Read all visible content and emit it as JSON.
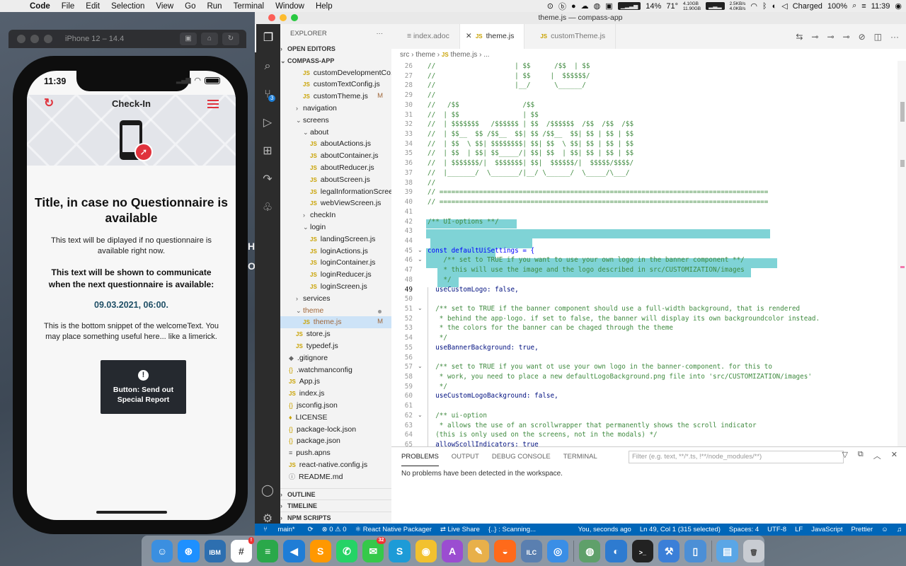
{
  "menubar": {
    "app_name": "Code",
    "items": [
      "File",
      "Edit",
      "Selection",
      "View",
      "Go",
      "Run",
      "Terminal",
      "Window",
      "Help"
    ],
    "status": {
      "cpu": "14%",
      "temp": "71°",
      "mem_used": "4.10GB",
      "mem_free": "11.90GB",
      "net_up": "2.5KB/s",
      "net_down": "4.0KB/s",
      "battery_label": "Charged",
      "battery_pct": "100%",
      "time": "11:39"
    }
  },
  "simulator": {
    "title": "iPhone 12 – 14.4",
    "status_time": "11:39",
    "app_title": "Check-In",
    "heading": "Title, in case no Questionnaire is available",
    "text1": "This text will be diplayed if no questionnaire is available right now.",
    "text2": "This text will be shown to communicate when the next questionnaire is available:",
    "date": "09.03.2021, 06:00.",
    "bottom": "This is the bottom snippet of the welcomeText. You may place something useful here... like a limerick.",
    "button_label": "Button: Send out Special Report"
  },
  "vscode": {
    "window_title": "theme.js — compass-app",
    "explorer_label": "EXPLORER",
    "open_editors_label": "OPEN EDITORS",
    "project_label": "COMPASS-APP",
    "tree": [
      {
        "label": "customDevelopmentCo...",
        "type": "js",
        "indent": 2
      },
      {
        "label": "customTextConfig.js",
        "type": "js",
        "indent": 2
      },
      {
        "label": "customTheme.js",
        "type": "js",
        "indent": 2,
        "status": "M"
      },
      {
        "label": "navigation",
        "type": "folder",
        "indent": 1,
        "arrow": "›"
      },
      {
        "label": "screens",
        "type": "folder",
        "indent": 1,
        "arrow": "⌄"
      },
      {
        "label": "about",
        "type": "folder",
        "indent": 2,
        "arrow": "⌄"
      },
      {
        "label": "aboutActions.js",
        "type": "js",
        "indent": 3
      },
      {
        "label": "aboutContainer.js",
        "type": "js",
        "indent": 3
      },
      {
        "label": "aboutReducer.js",
        "type": "js",
        "indent": 3
      },
      {
        "label": "aboutScreen.js",
        "type": "js",
        "indent": 3
      },
      {
        "label": "legalInformationScree...",
        "type": "js",
        "indent": 3
      },
      {
        "label": "webViewScreen.js",
        "type": "js",
        "indent": 3
      },
      {
        "label": "checkIn",
        "type": "folder",
        "indent": 2,
        "arrow": "›"
      },
      {
        "label": "login",
        "type": "folder",
        "indent": 2,
        "arrow": "⌄"
      },
      {
        "label": "landingScreen.js",
        "type": "js",
        "indent": 3
      },
      {
        "label": "loginActions.js",
        "type": "js",
        "indent": 3
      },
      {
        "label": "loginContainer.js",
        "type": "js",
        "indent": 3
      },
      {
        "label": "loginReducer.js",
        "type": "js",
        "indent": 3
      },
      {
        "label": "loginScreen.js",
        "type": "js",
        "indent": 3
      },
      {
        "label": "services",
        "type": "folder",
        "indent": 1,
        "arrow": "›"
      },
      {
        "label": "theme",
        "type": "folder",
        "indent": 1,
        "arrow": "⌄",
        "dot": true,
        "color": "#a0673a"
      },
      {
        "label": "theme.js",
        "type": "js",
        "indent": 2,
        "status": "M",
        "selected": true,
        "color": "#a0673a"
      },
      {
        "label": "store.js",
        "type": "js",
        "indent": 1
      },
      {
        "label": "typedef.js",
        "type": "js",
        "indent": 1
      },
      {
        "label": ".gitignore",
        "type": "git",
        "indent": 0
      },
      {
        "label": ".watchmanconfig",
        "type": "json",
        "indent": 0
      },
      {
        "label": "App.js",
        "type": "js",
        "indent": 0
      },
      {
        "label": "index.js",
        "type": "js",
        "indent": 0
      },
      {
        "label": "jsconfig.json",
        "type": "json",
        "indent": 0
      },
      {
        "label": "LICENSE",
        "type": "lic",
        "indent": 0
      },
      {
        "label": "package-lock.json",
        "type": "json",
        "indent": 0
      },
      {
        "label": "package.json",
        "type": "json",
        "indent": 0
      },
      {
        "label": "push.apns",
        "type": "other",
        "indent": 0
      },
      {
        "label": "react-native.config.js",
        "type": "js",
        "indent": 0
      },
      {
        "label": "README.md",
        "type": "info",
        "indent": 0
      }
    ],
    "outline_sections": [
      "OUTLINE",
      "TIMELINE",
      "NPM SCRIPTS"
    ],
    "tabs": [
      {
        "label": "index.adoc",
        "active": false
      },
      {
        "label": "theme.js",
        "active": true
      },
      {
        "label": "customTheme.js",
        "active": false
      }
    ],
    "breadcrumb": [
      "src",
      "theme",
      "theme.js",
      "..."
    ],
    "code_lines": [
      {
        "n": "26",
        "t": "//                    | $$      /$$  | $$",
        "cls": "c"
      },
      {
        "n": "27",
        "t": "//                    | $$     |  $$$$$$/",
        "cls": "c"
      },
      {
        "n": "28",
        "t": "//                    |__/      \\______/",
        "cls": "c"
      },
      {
        "n": "29",
        "t": "//",
        "cls": "c"
      },
      {
        "n": "30",
        "t": "//   /$$                /$$",
        "cls": "c"
      },
      {
        "n": "31",
        "t": "//  | $$                | $$",
        "cls": "c"
      },
      {
        "n": "32",
        "t": "//  | $$$$$$$   /$$$$$$ | $$  /$$$$$$  /$$  /$$  /$$",
        "cls": "c"
      },
      {
        "n": "33",
        "t": "//  | $$__  $$ /$$__  $$| $$ /$$__  $$| $$ | $$ | $$",
        "cls": "c"
      },
      {
        "n": "34",
        "t": "//  | $$  \\ $$| $$$$$$$$| $$| $$  \\ $$| $$ | $$ | $$",
        "cls": "c"
      },
      {
        "n": "35",
        "t": "//  | $$  | $$| $$_____/| $$| $$  | $$| $$ | $$ | $$",
        "cls": "c"
      },
      {
        "n": "36",
        "t": "//  | $$$$$$$/|  $$$$$$$| $$|  $$$$$$/|  $$$$$/$$$$/",
        "cls": "c"
      },
      {
        "n": "37",
        "t": "//  |_______/  \\_______/|__/ \\______/  \\_____/\\___/",
        "cls": "c"
      },
      {
        "n": "38",
        "t": "//",
        "cls": "c"
      },
      {
        "n": "39",
        "t": "// ===================================================================================",
        "cls": "c"
      },
      {
        "n": "40",
        "t": "// ===================================================================================",
        "cls": "c"
      },
      {
        "n": "41",
        "t": "",
        "cls": ""
      },
      {
        "n": "42",
        "t": "/** UI-options **/",
        "cls": "c"
      },
      {
        "n": "43",
        "t": "",
        "cls": ""
      },
      {
        "n": "44",
        "t": "",
        "cls": ""
      },
      {
        "n": "45",
        "t": "const defaultUiSettings = {",
        "cls": "k"
      },
      {
        "n": "46",
        "t": "    /** set to TRUE if you want to use your own logo in the banner component **/",
        "cls": "c"
      },
      {
        "n": "47",
        "t": "    * this will use the image and the logo described in src/CUSTOMIZATION/images",
        "cls": "c"
      },
      {
        "n": "48",
        "t": "    */",
        "cls": "c"
      },
      {
        "n": "49",
        "t": "  useCustomLogo: false,",
        "cls": "v"
      },
      {
        "n": "50",
        "t": "",
        "cls": ""
      },
      {
        "n": "51",
        "t": "  /** set to TRUE if the banner component should use a full-width background, that is rendered",
        "cls": "c"
      },
      {
        "n": "52",
        "t": "   * behind the app-logo. if set to false, the banner will display its own backgroundcolor instead.",
        "cls": "c"
      },
      {
        "n": "53",
        "t": "   * the colors for the banner can be chaged through the theme",
        "cls": "c"
      },
      {
        "n": "54",
        "t": "   */",
        "cls": "c"
      },
      {
        "n": "55",
        "t": "  useBannerBackground: true,",
        "cls": "v"
      },
      {
        "n": "56",
        "t": "",
        "cls": ""
      },
      {
        "n": "57",
        "t": "  /** set to TRUE if you want ot use your own logo in the banner-component. for this to",
        "cls": "c"
      },
      {
        "n": "58",
        "t": "   * work, you need to place a new defaultLogoBackground.png file into 'src/CUSTOMIZATION/images'",
        "cls": "c"
      },
      {
        "n": "59",
        "t": "   */",
        "cls": "c"
      },
      {
        "n": "60",
        "t": "  useCustomLogoBackground: false,",
        "cls": "v"
      },
      {
        "n": "61",
        "t": "",
        "cls": ""
      },
      {
        "n": "62",
        "t": "  /** ui-option",
        "cls": "c"
      },
      {
        "n": "63",
        "t": "   * allows the use of an scrollwrapper that permanently shows the scroll indicator",
        "cls": "c"
      },
      {
        "n": "64",
        "t": "  (this is only used on the screens, not in the modals) */",
        "cls": "c"
      },
      {
        "n": "65",
        "t": "  allowScollIndicators: true",
        "cls": "v"
      }
    ],
    "panel": {
      "tabs": [
        "PROBLEMS",
        "OUTPUT",
        "DEBUG CONSOLE",
        "TERMINAL"
      ],
      "filter_placeholder": "Filter (e.g. text, **/*.ts, !**/node_modules/**)",
      "message": "No problems have been detected in the workspace."
    },
    "statusbar": {
      "branch": "main*",
      "sync": "⟳",
      "problems": "⊗ 0 ⚠ 0",
      "packager": "⚛ React Native Packager",
      "liveshare": "⇄ Live Share",
      "scanning": "{..} : Scanning...",
      "blame": "You, seconds ago",
      "position": "Ln 49, Col 1 (315 selected)",
      "spaces": "Spaces: 4",
      "encoding": "UTF-8",
      "eol": "LF",
      "language": "JavaScript",
      "formatter": "Prettier"
    }
  },
  "dock": {
    "apps": [
      {
        "name": "finder-icon",
        "color": "#3b8fe0",
        "g": "☺"
      },
      {
        "name": "safari-icon",
        "color": "#1e90ff",
        "g": "⊛"
      },
      {
        "name": "ibm-app-icon",
        "color": "#2d6fb0",
        "g": "IBM"
      },
      {
        "name": "slack-icon",
        "color": "#ffffff",
        "g": "#",
        "badge": "!"
      },
      {
        "name": "sourcetree-icon",
        "color": "#2aa84a",
        "g": "≡"
      },
      {
        "name": "vscode-icon",
        "color": "#1f7dd6",
        "g": "◀"
      },
      {
        "name": "sublime-icon",
        "color": "#ff9800",
        "g": "S"
      },
      {
        "name": "whatsapp-icon",
        "color": "#25d366",
        "g": "✆"
      },
      {
        "name": "messages-icon",
        "color": "#35c94a",
        "g": "✉",
        "badge": "32"
      },
      {
        "name": "skype-icon",
        "color": "#1d9bd7",
        "g": "S"
      },
      {
        "name": "chrome-icon",
        "color": "#f2c12e",
        "g": "◉"
      },
      {
        "name": "affinity-icon",
        "color": "#9b4dd1",
        "g": "A"
      },
      {
        "name": "notes-app-icon",
        "color": "#e8b04a",
        "g": "✎"
      },
      {
        "name": "firefox-icon",
        "color": "#ff6a1a",
        "g": "◒"
      },
      {
        "name": "ilc-icon",
        "color": "#5a7fb0",
        "g": "ILC"
      },
      {
        "name": "airdrop-icon",
        "color": "#3a8ee6",
        "g": "◎"
      },
      {
        "name": "sep",
        "color": "",
        "g": ""
      },
      {
        "name": "globe-icon",
        "color": "#5fa06a",
        "g": "◍"
      },
      {
        "name": "camera-icon",
        "color": "#2e7bd0",
        "g": "◐"
      },
      {
        "name": "terminal-icon",
        "color": "#222222",
        "g": ">_"
      },
      {
        "name": "xcode-icon",
        "color": "#3b7fd8",
        "g": "⚒"
      },
      {
        "name": "simulator-icon",
        "color": "#4c8fd6",
        "g": "▯"
      },
      {
        "name": "sep",
        "color": "",
        "g": ""
      },
      {
        "name": "folder-icon",
        "color": "#5aa6e6",
        "g": "▤"
      },
      {
        "name": "trash-icon",
        "color": "#c8ccd2",
        "g": "🗑"
      }
    ]
  }
}
